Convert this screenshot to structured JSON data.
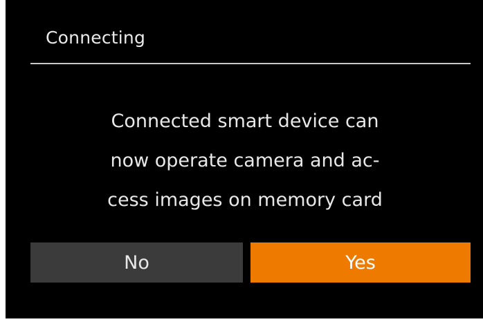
{
  "dialog": {
    "title": "Connecting",
    "message_lines": [
      "Connected smart device can",
      "now operate camera and ac-",
      "cess images on memory card"
    ],
    "buttons": {
      "no_label": "No",
      "yes_label": "Yes"
    }
  },
  "colors": {
    "background": "#000000",
    "selected_button": "#ee7a00",
    "unselected_button": "#3b3b3b",
    "divider": "#c8c8c8"
  }
}
